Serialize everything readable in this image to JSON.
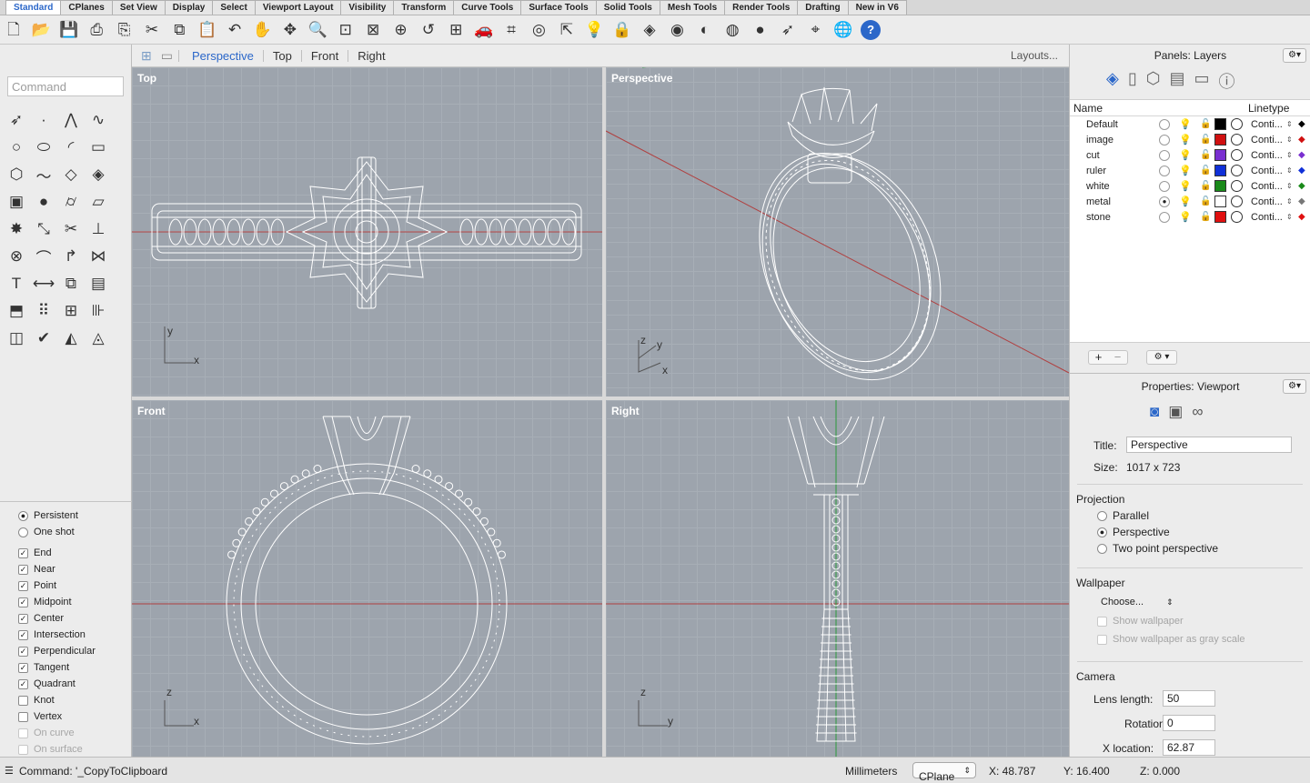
{
  "tabs": [
    "Standard",
    "CPlanes",
    "Set View",
    "Display",
    "Select",
    "Viewport Layout",
    "Visibility",
    "Transform",
    "Curve Tools",
    "Surface Tools",
    "Solid Tools",
    "Mesh Tools",
    "Render Tools",
    "Drafting",
    "New in V6"
  ],
  "active_tab": "Standard",
  "toolbar_icons": [
    "new-file-icon",
    "open-folder-icon",
    "save-icon",
    "print-icon",
    "import-icon",
    "cut-icon",
    "copy-icon",
    "paste-icon",
    "undo-icon",
    "pan-hand-icon",
    "rotate-view-icon",
    "zoom-icon",
    "zoom-window-icon",
    "zoom-extents-icon",
    "zoom-selected-icon",
    "undo-view-icon",
    "four-viewports-icon",
    "car-icon",
    "grid-options-icon",
    "select-icon",
    "move-icon",
    "light-icon",
    "lock-icon",
    "layer-icon",
    "color-wheel-icon",
    "shaded-sphere-icon",
    "mesh-sphere-icon",
    "render-sphere-icon",
    "pointer-icon",
    "osnap-icon",
    "globe-icon",
    "help-icon"
  ],
  "command_placeholder": "Command",
  "tool_icons": [
    "arrow-select-icon",
    "point-icon",
    "polyline-icon",
    "curve-icon",
    "circle-icon",
    "ellipse-icon",
    "arc-icon",
    "rectangle-icon",
    "polygon-icon",
    "free-curve-icon",
    "surface-icon",
    "patch-icon",
    "box-icon",
    "sphere-icon",
    "cylinder-icon",
    "plane-icon",
    "explode-icon",
    "transform-icon",
    "trim-icon",
    "split-icon",
    "boolean-icon",
    "loft-icon",
    "fillet-icon",
    "join-icon",
    "text-icon",
    "dimension-icon",
    "group-icon",
    "block-icon",
    "extrude-icon",
    "array-icon",
    "grid-icon",
    "align-icon",
    "analyze-icon",
    "check-icon",
    "render-icon",
    "cplane-icon"
  ],
  "osnap": {
    "modes": [
      {
        "label": "Persistent",
        "checked": true
      },
      {
        "label": "One shot",
        "checked": false
      }
    ],
    "snaps": [
      {
        "label": "End",
        "checked": true,
        "disabled": false
      },
      {
        "label": "Near",
        "checked": true,
        "disabled": false
      },
      {
        "label": "Point",
        "checked": true,
        "disabled": false
      },
      {
        "label": "Midpoint",
        "checked": true,
        "disabled": false
      },
      {
        "label": "Center",
        "checked": true,
        "disabled": false
      },
      {
        "label": "Intersection",
        "checked": true,
        "disabled": false
      },
      {
        "label": "Perpendicular",
        "checked": true,
        "disabled": false
      },
      {
        "label": "Tangent",
        "checked": true,
        "disabled": false
      },
      {
        "label": "Quadrant",
        "checked": true,
        "disabled": false
      },
      {
        "label": "Knot",
        "checked": false,
        "disabled": false
      },
      {
        "label": "Vertex",
        "checked": false,
        "disabled": false
      },
      {
        "label": "On curve",
        "checked": false,
        "disabled": true
      },
      {
        "label": "On surface",
        "checked": false,
        "disabled": true
      }
    ]
  },
  "viewport_tabs": {
    "items": [
      "Perspective",
      "Top",
      "Front",
      "Right"
    ],
    "active": "Perspective",
    "layouts": "Layouts..."
  },
  "viewports": {
    "top": {
      "label": "Top",
      "axis1": "y",
      "axis2": "x"
    },
    "perspective": {
      "label": "Perspective",
      "axis1": "z",
      "axis2": "y",
      "axis3": "x"
    },
    "front": {
      "label": "Front",
      "axis1": "z",
      "axis2": "x"
    },
    "right": {
      "label": "Right",
      "axis1": "z",
      "axis2": "y"
    }
  },
  "layers_panel": {
    "title": "Panels: Layers",
    "col_name": "Name",
    "col_linetype": "Linetype",
    "layers": [
      {
        "name": "Default",
        "color": "#000000",
        "linetype": "Conti...",
        "current": false,
        "bulb": "off"
      },
      {
        "name": "image",
        "color": "#d01010",
        "linetype": "Conti...",
        "current": false,
        "bulb": "off"
      },
      {
        "name": "cut",
        "color": "#7a2fd0",
        "linetype": "Conti...",
        "current": false,
        "bulb": "off"
      },
      {
        "name": "ruler",
        "color": "#1030d8",
        "linetype": "Conti...",
        "current": false,
        "bulb": "off"
      },
      {
        "name": "white",
        "color": "#1a8a1a",
        "linetype": "Conti...",
        "current": false,
        "bulb": "on"
      },
      {
        "name": "metal",
        "color": "#ffffff",
        "linetype": "Conti...",
        "current": true,
        "bulb": "on"
      },
      {
        "name": "stone",
        "color": "#e01010",
        "linetype": "Conti...",
        "current": false,
        "bulb": "off"
      }
    ]
  },
  "properties_panel": {
    "title": "Properties: Viewport",
    "title_label": "Title:",
    "title_value": "Perspective",
    "size_label": "Size:",
    "size_value": "1017 x 723",
    "projection_label": "Projection",
    "projection_options": [
      "Parallel",
      "Perspective",
      "Two point perspective"
    ],
    "projection_selected": "Perspective",
    "wallpaper_label": "Wallpaper",
    "wallpaper_choose": "Choose...",
    "show_wallpaper": "Show wallpaper",
    "show_gray": "Show wallpaper as gray scale",
    "camera_label": "Camera",
    "lens_label": "Lens length:",
    "lens_value": "50",
    "rotation_label": "Rotation:",
    "rotation_value": "0",
    "xloc_label": "X location:",
    "xloc_value": "62.87"
  },
  "status": {
    "command": "Command: '_CopyToClipboard",
    "units": "Millimeters",
    "cplane": "CPlane",
    "x": "X: 48.787",
    "y": "Y: 16.400",
    "z": "Z: 0.000"
  },
  "colors": {
    "accent": "#2b67c9",
    "viewport_bg": "#9da4ad",
    "x_axis": "#c0392b",
    "y_axis": "#2a9a3a"
  }
}
